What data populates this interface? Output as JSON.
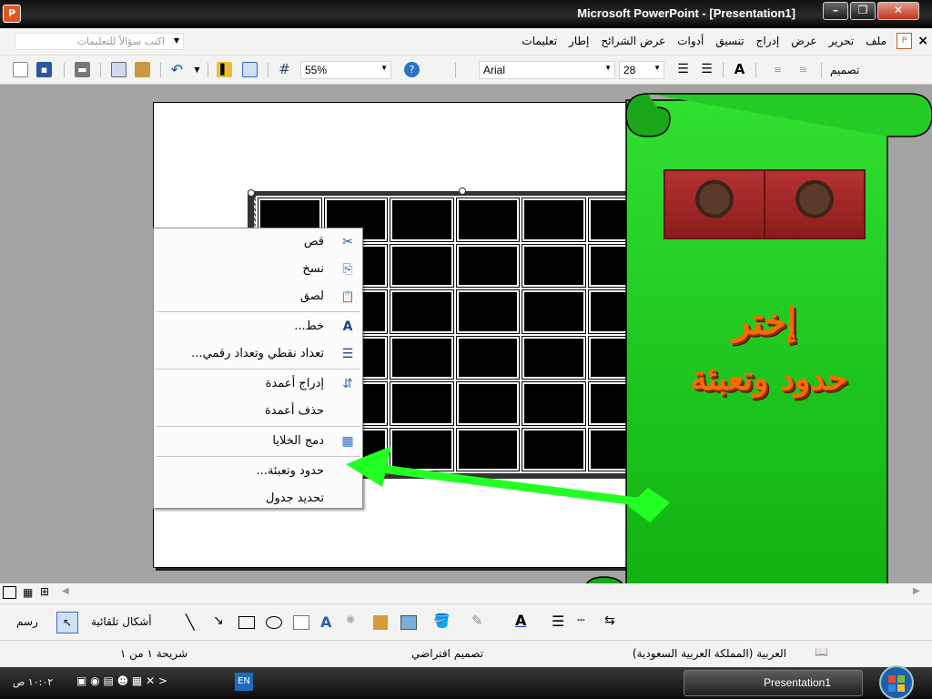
{
  "window": {
    "title": "Microsoft PowerPoint - [Presentation1]",
    "app_icon_glyph": "P"
  },
  "menubar": {
    "items": [
      "ملف",
      "تحرير",
      "عرض",
      "إدراج",
      "تنسيق",
      "أدوات",
      "عرض الشرائح",
      "إطار",
      "تعليمات"
    ],
    "ask_placeholder": "اكتب سؤالاً للتعليمات",
    "close_glyph": "×"
  },
  "toolbar": {
    "zoom": "55%",
    "font_name": "Arial",
    "font_size": "28",
    "design_label": "تصميم"
  },
  "context_menu": {
    "items": [
      {
        "label": "قص",
        "icon": "scissors-icon",
        "glyph": "✂"
      },
      {
        "label": "نسخ",
        "icon": "copy-icon",
        "glyph": "⎘"
      },
      {
        "label": "لصق",
        "icon": "paste-icon",
        "glyph": "📋"
      },
      {
        "label": "خط...",
        "icon": "font-icon",
        "glyph": "A"
      },
      {
        "label": "تعداد نقطي وتعداد رقمي...",
        "icon": "bullets-icon",
        "glyph": "☰"
      },
      {
        "label": "إدراج أعمدة",
        "icon": "insert-columns-icon",
        "glyph": "⇵"
      },
      {
        "label": "حذف أعمدة",
        "icon": "",
        "glyph": ""
      },
      {
        "label": "دمج الخلايا",
        "icon": "merge-cells-icon",
        "glyph": "▦"
      },
      {
        "label": "حدود وتعبئة...",
        "icon": "",
        "glyph": ""
      },
      {
        "label": "تحديد جدول",
        "icon": "",
        "glyph": ""
      }
    ]
  },
  "annotation_banner": {
    "line1": "إختر",
    "line2": "حدود وتعبئة",
    "bg_color": "#1fc21f",
    "text_color": "#ff6a00"
  },
  "drawbar": {
    "draw_label": "رسم",
    "autoshapes_label": "أشكال تلقائية"
  },
  "statusbar": {
    "slide_info": "شريحة ١ من ١",
    "design": "تصميم افتراضي",
    "language": "العربية (المملكة العربية السعودية)"
  },
  "taskbar": {
    "task_label": "Presentation1",
    "clock": "١٠:٠٢ ص",
    "lang": "EN"
  }
}
